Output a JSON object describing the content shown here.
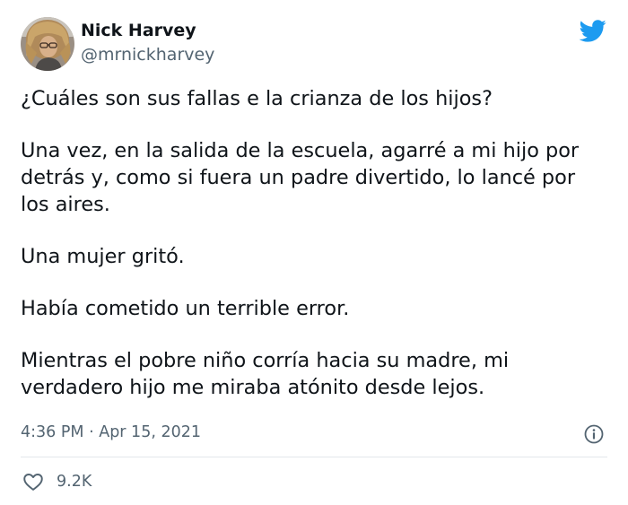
{
  "author": {
    "name": "Nick Harvey",
    "handle": "@mrnickharvey",
    "avatar_icon": "profile-photo"
  },
  "brand": {
    "icon": "twitter-bird-icon",
    "color": "#1d9bf0"
  },
  "tweet": {
    "lines": [
      [
        "¿Cuáles son sus fallas e la crianza de los hijos?"
      ],
      [
        "Una vez, en la salida de la escuela, agarré a mi hijo por",
        "detrás y, como si fuera un padre divertido, lo lancé por",
        "los aires."
      ],
      [
        "Una mujer gritó."
      ],
      [
        "Había cometido un terrible error."
      ],
      [
        "Mientras el pobre niño corría hacia su madre, mi",
        "verdadero hijo me miraba atónito desde lejos."
      ]
    ]
  },
  "meta": {
    "time": "4:36 PM",
    "separator": " · ",
    "date": "Apr 15, 2021",
    "info_icon": "info-icon"
  },
  "engagement": {
    "like_icon": "heart-icon",
    "likes": "9.2K"
  },
  "colors": {
    "text": "#0f1419",
    "secondary": "#536471",
    "divider": "#e3e8ec",
    "background": "#ffffff"
  }
}
